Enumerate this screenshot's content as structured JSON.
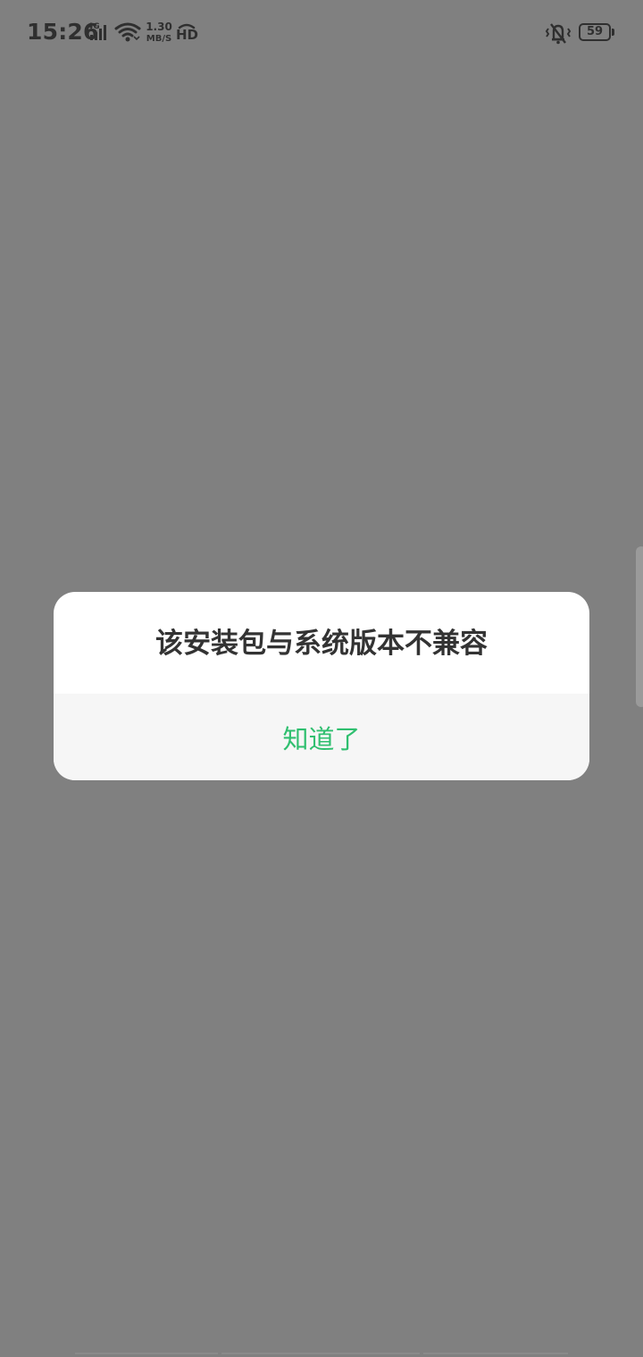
{
  "status_bar": {
    "time": "15:26",
    "network_type": "4G",
    "speed_value": "1.30",
    "speed_unit": "MB/S",
    "hd_label": "HD",
    "battery_level": "59"
  },
  "dialog": {
    "message": "该安装包与系统版本不兼容",
    "confirm_label": "知道了"
  },
  "colors": {
    "overlay": "#808080",
    "accent": "#2fbf6f",
    "dialog_bg": "#ffffff",
    "button_bg": "#f6f6f6",
    "text_primary": "#333333"
  }
}
